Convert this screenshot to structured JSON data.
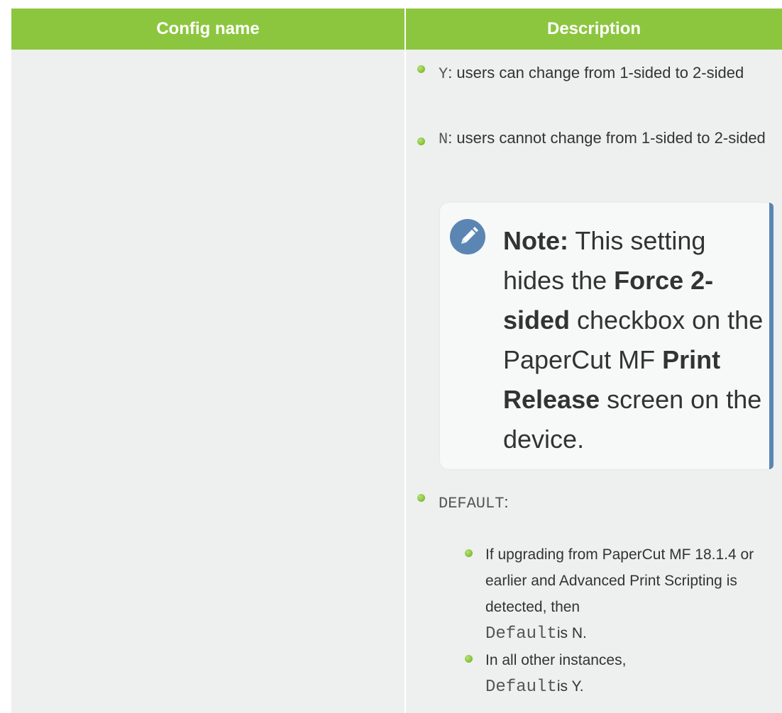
{
  "table": {
    "headers": {
      "config_name": "Config name",
      "description": "Description"
    }
  },
  "description": {
    "items": [
      {
        "code": "Y",
        "text": ": users can change from 1-sided to 2-sided"
      },
      {
        "code": "N",
        "text": ": users cannot change from 1-sided to 2-sided"
      }
    ],
    "note": {
      "label": "Note:",
      "t1": " This setting hides the ",
      "b1": "Force 2-sided",
      "t2": " checkbox on the PaperCut MF ",
      "b2": "Print Release",
      "t3": " screen on the device.",
      "icon": "pencil-icon"
    },
    "default_item": {
      "code": "DEFAULT",
      "text": ":"
    },
    "sub_items": [
      {
        "text": "If upgrading from PaperCut MF 18.1.4 or earlier and Advanced Print Scripting is detected, then",
        "code": "Default",
        "suffix": "is N."
      },
      {
        "text": "In all other instances,",
        "code": "Default",
        "suffix": "is Y."
      }
    ]
  },
  "colors": {
    "header": "#8cc63f",
    "cell": "#edf0ef",
    "note_bar": "#5b86b3",
    "bullet": "#8cc63f"
  }
}
